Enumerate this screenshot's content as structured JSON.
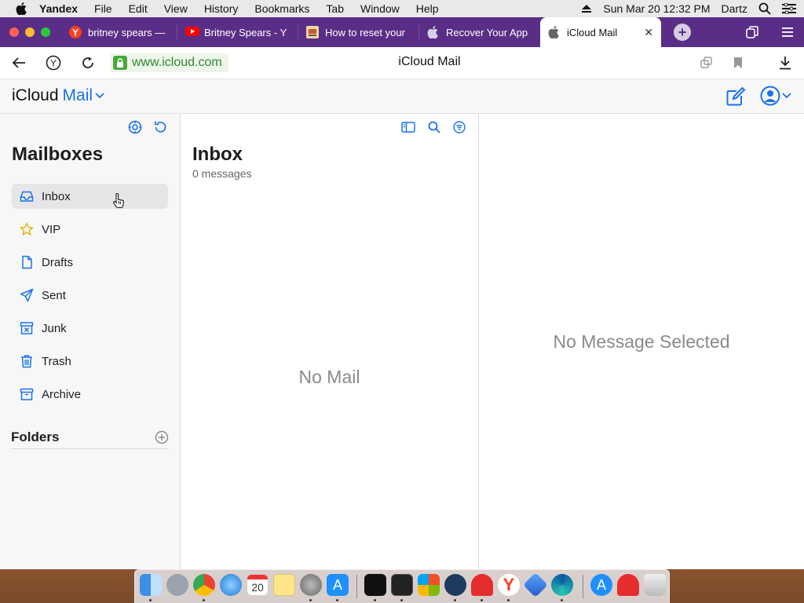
{
  "menubar": {
    "app": "Yandex",
    "items": [
      "File",
      "Edit",
      "View",
      "History",
      "Bookmarks",
      "Tab",
      "Window",
      "Help"
    ],
    "clock": "Sun Mar 20  12:32 PM",
    "user": "Dartz"
  },
  "tabs": [
    {
      "title": "britney spears —",
      "favicon": "yandex-icon"
    },
    {
      "title": "Britney Spears - Y",
      "favicon": "youtube-icon"
    },
    {
      "title": "How to reset your",
      "favicon": "article-icon"
    },
    {
      "title": "Recover Your App",
      "favicon": "apple-icon"
    },
    {
      "title": "iCloud Mail",
      "favicon": "apple-icon",
      "active": true
    }
  ],
  "addressbar": {
    "url": "www.icloud.com",
    "page_title": "iCloud Mail"
  },
  "header": {
    "brand_prefix": "iCloud",
    "brand_app": "Mail"
  },
  "sidebar": {
    "title": "Mailboxes",
    "mailboxes": [
      {
        "label": "Inbox",
        "icon": "inbox-icon",
        "selected": true
      },
      {
        "label": "VIP",
        "icon": "star-icon"
      },
      {
        "label": "Drafts",
        "icon": "document-icon"
      },
      {
        "label": "Sent",
        "icon": "paper-plane-icon"
      },
      {
        "label": "Junk",
        "icon": "junk-icon"
      },
      {
        "label": "Trash",
        "icon": "trash-icon"
      },
      {
        "label": "Archive",
        "icon": "archive-icon"
      }
    ],
    "folders_label": "Folders"
  },
  "message_list": {
    "title": "Inbox",
    "count": "0 messages",
    "empty": "No Mail"
  },
  "reader": {
    "empty": "No Message Selected"
  },
  "dock": {
    "calendar_day": "20",
    "apps": [
      "finder-icon",
      "launchpad-icon",
      "chrome-icon",
      "safari-icon",
      "calendar-icon",
      "notes-icon",
      "system-preferences-icon",
      "app-store-icon",
      "activity-monitor-icon",
      "terminal-icon",
      "microsoft-icon",
      "vpn-icon",
      "magnet-icon",
      "yandex-browser-icon",
      "vscode-icon",
      "edge-icon",
      "app-store-downloads-icon",
      "magnet-icon-2",
      "trash-icon"
    ]
  },
  "colors": {
    "accent": "#1a73e8",
    "tabstrip": "#5a2e86",
    "url_green": "#2f8a2f"
  }
}
